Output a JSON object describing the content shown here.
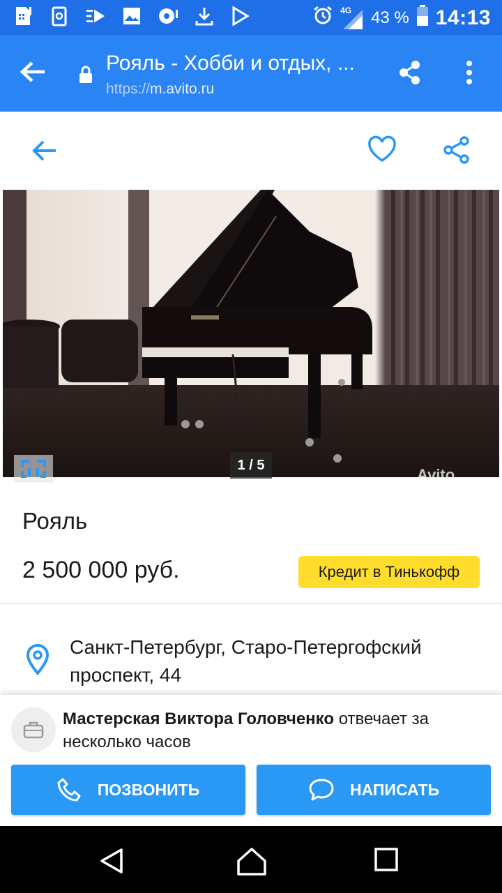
{
  "status_bar": {
    "network": "4G",
    "battery_percent": "43 %",
    "time": "14:13",
    "icons": [
      "sim-icon",
      "clipboard-icon",
      "cast-icon",
      "gallery-icon",
      "record-icon",
      "download-icon",
      "play-store-icon",
      "alarm-icon",
      "signal-icon",
      "battery-icon"
    ]
  },
  "browser": {
    "page_title": "Рояль - Хобби и отдых, ...",
    "url_protocol": "https://",
    "url_domain": "m.avito.ru"
  },
  "listing": {
    "photo_counter": "1 / 5",
    "watermark": "Avito",
    "title": "Рояль",
    "price": "2 500 000 руб.",
    "credit_button": "Кредит в Тинькофф",
    "address": "Санкт-Петербург, Старо-Петергофский проспект, 44"
  },
  "seller": {
    "name": "Мастерская Виктора Головченко",
    "response_text": " отвечает за несколько часов"
  },
  "actions": {
    "call_label": "ПОЗВОНИТЬ",
    "write_label": "НАПИСАТЬ"
  },
  "colors": {
    "status_bar": "#1e6fe8",
    "url_bar": "#2a84f3",
    "accent": "#2a98f5",
    "credit": "#ffdd2d"
  }
}
